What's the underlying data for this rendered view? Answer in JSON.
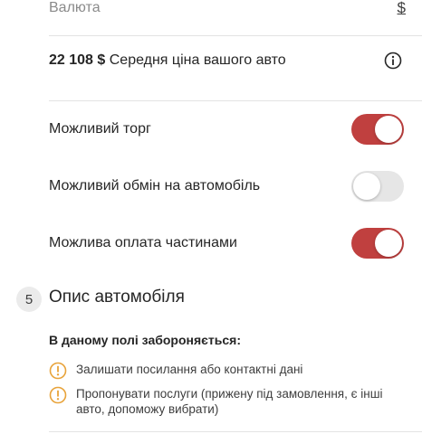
{
  "currency": {
    "label": "Валюта",
    "symbol": "$"
  },
  "price": {
    "value": "22 108 $",
    "caption": "Середня ціна вашого авто"
  },
  "options": [
    {
      "label": "Можливий торг",
      "enabled": true
    },
    {
      "label": "Можливий обмін на автомобіль",
      "enabled": false
    },
    {
      "label": "Можлива оплата частинами",
      "enabled": true
    }
  ],
  "section": {
    "number": "5",
    "title": "Опис автомобіля"
  },
  "rules": {
    "heading": "В даному полі забороняється:",
    "items": [
      "Залишати посилання або контактні дані",
      "Пропонувати послуги (прижену під замовлення, є інші авто, допоможу вибрати)"
    ]
  },
  "colors": {
    "accent": "#c0403f",
    "warning": "#e8a33a"
  }
}
